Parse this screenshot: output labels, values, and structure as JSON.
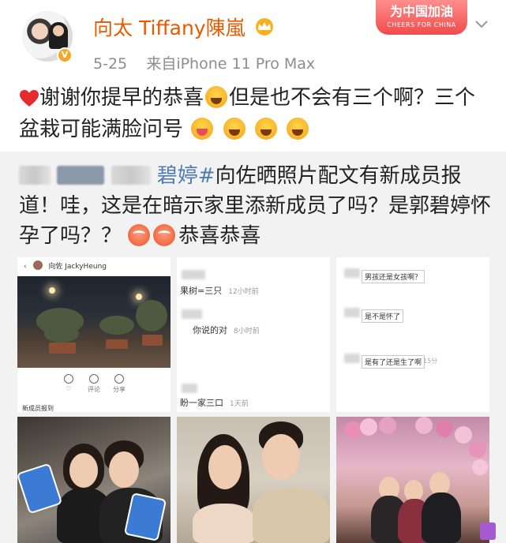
{
  "header": {
    "username": "向太 Tiffany陳嵐",
    "date": "5-25",
    "source": "来自iPhone 11 Pro Max",
    "verified_badge": "V",
    "campaign_badge_title": "为中国加油",
    "campaign_badge_subtitle": "CHEERS FOR CHINA",
    "icons": [
      "avatar",
      "crown-icon",
      "verified-icon",
      "chevron-down-icon"
    ]
  },
  "post": {
    "text_1": "谢谢你提早的恭喜",
    "text_2": "但是也不会有三个啊？三个盆栽可能满脸问号",
    "emojis": [
      "heart-icon",
      "laugh-cry-icon",
      "wink-icon",
      "grin-icon",
      "grin-icon",
      "grin-icon"
    ]
  },
  "repost": {
    "hashtag_partial": "碧婷#",
    "text_1": "向佐晒照片配文有新成员报道！哇，这是在暗示家里添新成员了吗？是郭碧婷怀孕了吗？？",
    "text_2": "恭喜恭喜",
    "ig_user": "向佐 JackyHeung",
    "ig_caption": "新成员报到",
    "ig_actions": [
      "♡",
      "评论",
      "分享"
    ],
    "comments_a": [
      {
        "text": "果树=三只",
        "time": "12小时前"
      },
      {
        "text": "你说的对",
        "time": "8小时前"
      },
      {
        "text": "盼一家三口",
        "time": "1天前"
      }
    ],
    "comments_b": [
      {
        "text": "男孩还是女孩啊？"
      },
      {
        "text": "是不是怀了"
      },
      {
        "text": "是有了还是生了啊",
        "time": "15分"
      }
    ]
  },
  "colors": {
    "username": "#e85a00",
    "meta": "#8d8d8d",
    "link": "#507daf",
    "repost_bg": "#f2f2f2",
    "badge": "#f04b4b"
  }
}
